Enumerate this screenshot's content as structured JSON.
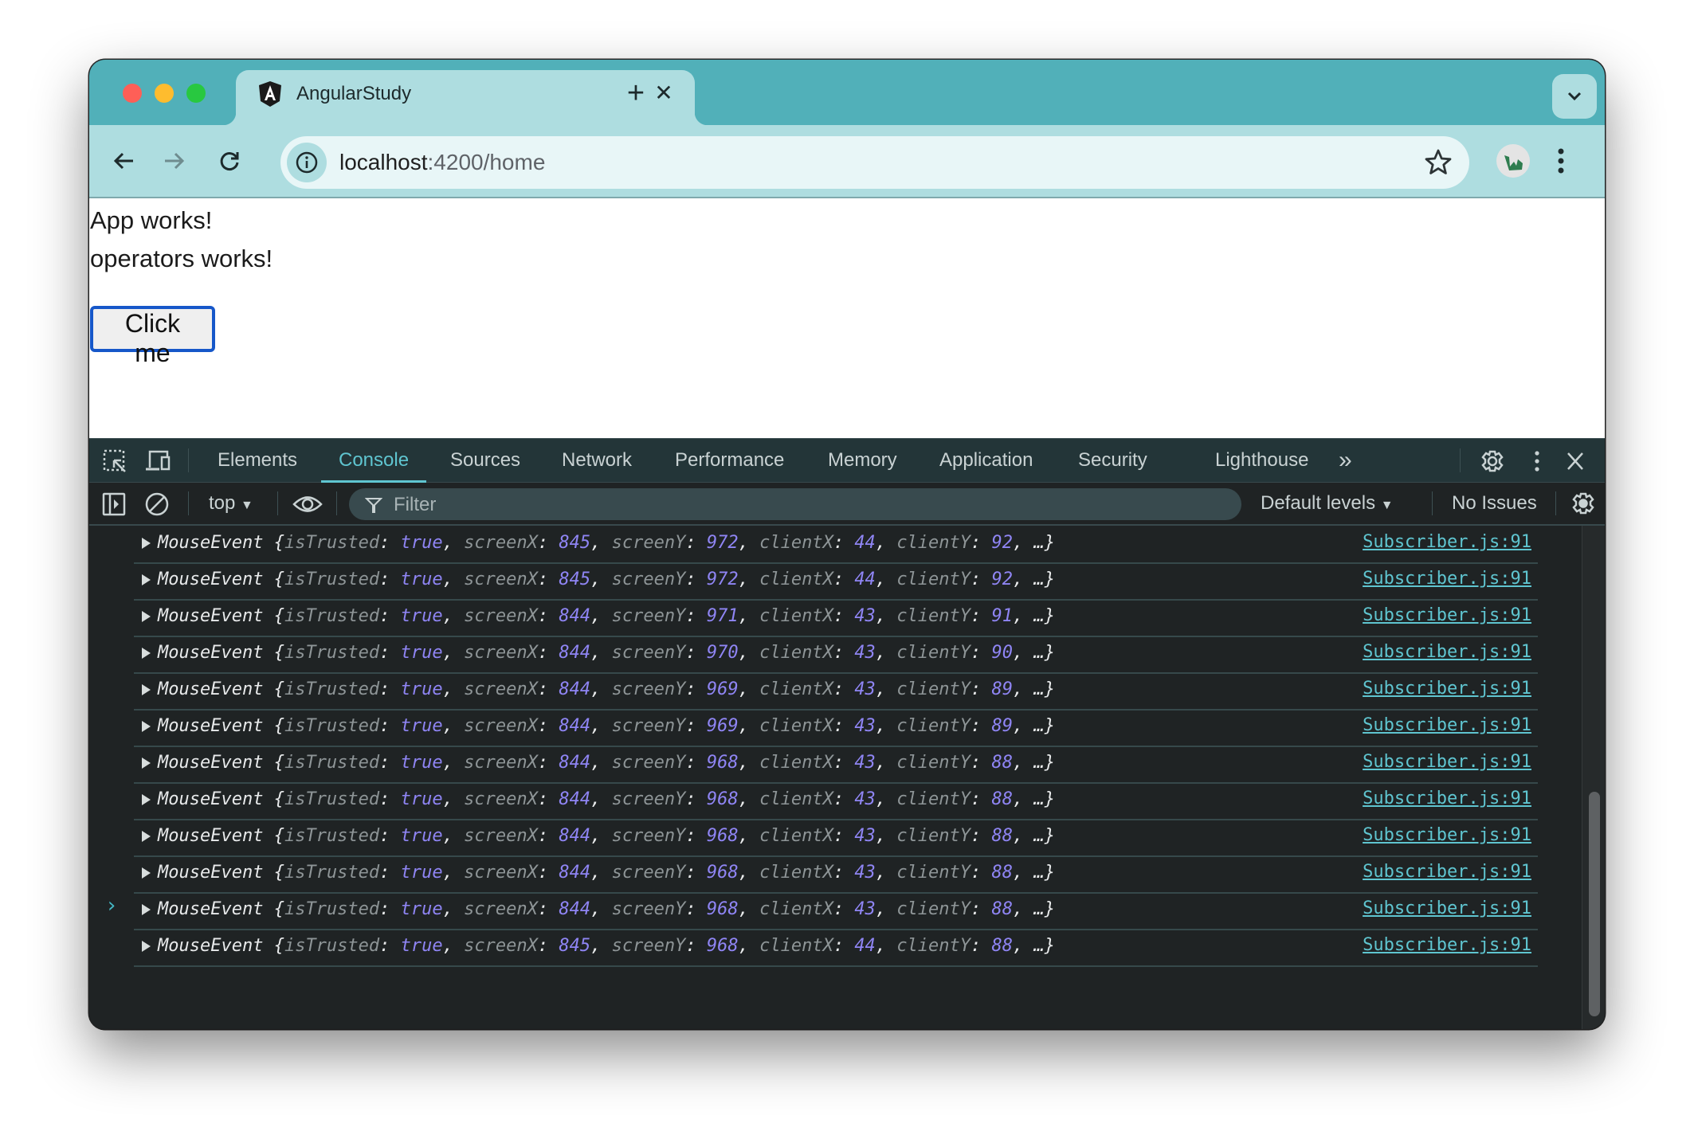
{
  "browser": {
    "tab": {
      "title": "AngularStudy",
      "favicon": "angular-icon",
      "close_glyph": "✕"
    },
    "new_tab_glyph": "+",
    "address_bar": {
      "host": "localhost",
      "port_path": ":4200/home"
    },
    "icons": {
      "back": "back-arrow-icon",
      "forward": "forward-arrow-icon",
      "reload": "reload-icon",
      "site_info": "info-icon",
      "bookmark": "star-icon",
      "profile": "avatar",
      "menu": "kebab-menu-icon",
      "tab_search": "chevron-down-icon"
    }
  },
  "page": {
    "line1": "App works!",
    "line2": "operators works!",
    "button_label": "Click me"
  },
  "devtools": {
    "tabs": [
      "Elements",
      "Console",
      "Sources",
      "Network",
      "Performance",
      "Memory",
      "Application",
      "Security",
      "Lighthouse"
    ],
    "active_tab": "Console",
    "more_tabs_glyph": "»",
    "console_toolbar": {
      "context": "top",
      "filter_placeholder": "Filter",
      "levels": "Default levels",
      "issues": "No Issues"
    },
    "logs": [
      {
        "type": "MouseEvent",
        "isTrusted": "true",
        "screenX": "845",
        "screenY": "972",
        "clientX": "44",
        "clientY": "92",
        "source": "Subscriber.js:91"
      },
      {
        "type": "MouseEvent",
        "isTrusted": "true",
        "screenX": "845",
        "screenY": "972",
        "clientX": "44",
        "clientY": "92",
        "source": "Subscriber.js:91"
      },
      {
        "type": "MouseEvent",
        "isTrusted": "true",
        "screenX": "844",
        "screenY": "971",
        "clientX": "43",
        "clientY": "91",
        "source": "Subscriber.js:91"
      },
      {
        "type": "MouseEvent",
        "isTrusted": "true",
        "screenX": "844",
        "screenY": "970",
        "clientX": "43",
        "clientY": "90",
        "source": "Subscriber.js:91"
      },
      {
        "type": "MouseEvent",
        "isTrusted": "true",
        "screenX": "844",
        "screenY": "969",
        "clientX": "43",
        "clientY": "89",
        "source": "Subscriber.js:91"
      },
      {
        "type": "MouseEvent",
        "isTrusted": "true",
        "screenX": "844",
        "screenY": "969",
        "clientX": "43",
        "clientY": "89",
        "source": "Subscriber.js:91"
      },
      {
        "type": "MouseEvent",
        "isTrusted": "true",
        "screenX": "844",
        "screenY": "968",
        "clientX": "43",
        "clientY": "88",
        "source": "Subscriber.js:91"
      },
      {
        "type": "MouseEvent",
        "isTrusted": "true",
        "screenX": "844",
        "screenY": "968",
        "clientX": "43",
        "clientY": "88",
        "source": "Subscriber.js:91"
      },
      {
        "type": "MouseEvent",
        "isTrusted": "true",
        "screenX": "844",
        "screenY": "968",
        "clientX": "43",
        "clientY": "88",
        "source": "Subscriber.js:91"
      },
      {
        "type": "MouseEvent",
        "isTrusted": "true",
        "screenX": "844",
        "screenY": "968",
        "clientX": "43",
        "clientY": "88",
        "source": "Subscriber.js:91"
      },
      {
        "type": "MouseEvent",
        "isTrusted": "true",
        "screenX": "844",
        "screenY": "968",
        "clientX": "43",
        "clientY": "88",
        "source": "Subscriber.js:91"
      },
      {
        "type": "MouseEvent",
        "isTrusted": "true",
        "screenX": "845",
        "screenY": "968",
        "clientX": "44",
        "clientY": "88",
        "source": "Subscriber.js:91"
      }
    ],
    "prompt_glyph": "›"
  },
  "colors": {
    "tabstrip": "#51b0b9",
    "toolbar": "#aedde0",
    "accent": "#5fc5d0",
    "value": "#8f85f4",
    "button_focus": "#1657c9"
  }
}
